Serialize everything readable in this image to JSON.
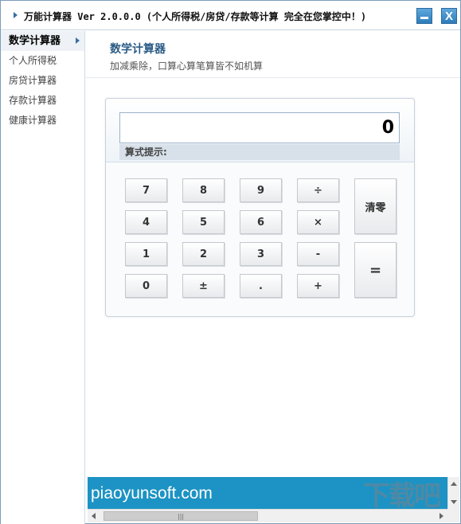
{
  "window": {
    "title": "万能计算器 Ver 2.0.0.0 (个人所得税/房贷/存款等计算 完全在您掌控中！)",
    "minimize_icon": "minimize-icon",
    "close_label": "X"
  },
  "sidebar": {
    "items": [
      {
        "label": "数学计算器",
        "active": true
      },
      {
        "label": "个人所得税",
        "active": false
      },
      {
        "label": "房贷计算器",
        "active": false
      },
      {
        "label": "存款计算器",
        "active": false
      },
      {
        "label": "健康计算器",
        "active": false
      }
    ]
  },
  "header": {
    "title": "数学计算器",
    "subtitle": "加减乘除，口算心算笔算皆不如机算"
  },
  "calculator": {
    "display_value": "0",
    "hint_label": "算式提示:",
    "keys": {
      "k7": "7",
      "k8": "8",
      "k9": "9",
      "div": "÷",
      "k4": "4",
      "k5": "5",
      "k6": "6",
      "mul": "×",
      "k1": "1",
      "k2": "2",
      "k3": "3",
      "sub": "-",
      "k0": "0",
      "sign": "±",
      "dot": ".",
      "add": "+",
      "clear": "清零",
      "equals": "="
    }
  },
  "banner": {
    "text": "piaoyunsoft.com",
    "watermark": "下载吧"
  },
  "colors": {
    "accent": "#2a5b86",
    "banner": "#1c93c4"
  }
}
